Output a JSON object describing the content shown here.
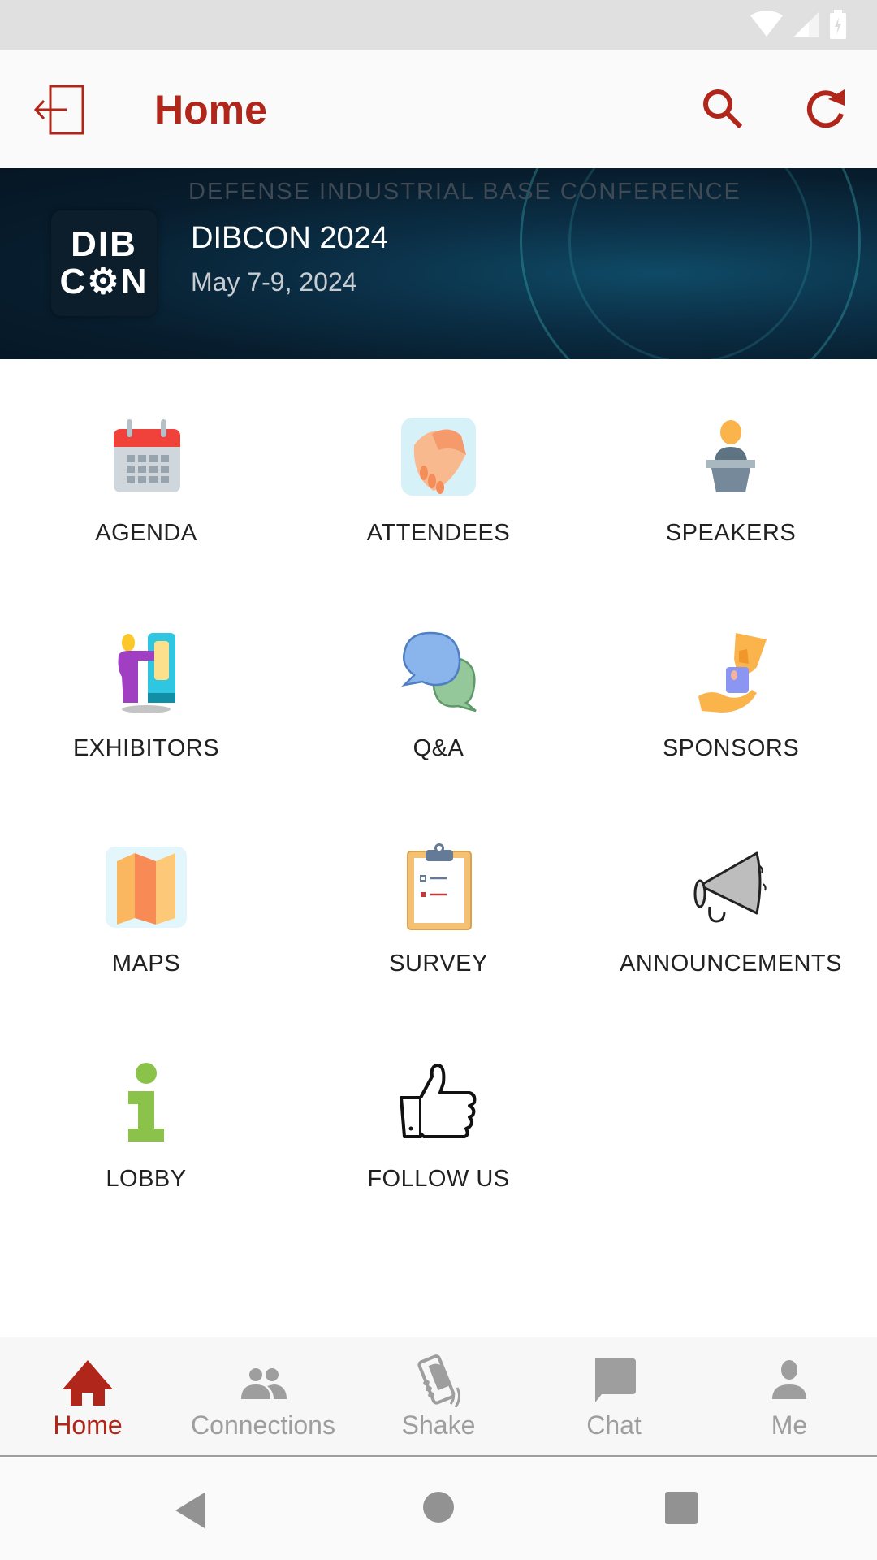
{
  "status_bar": {
    "icons": [
      "wifi-icon",
      "cell-signal-icon",
      "battery-charging-icon"
    ]
  },
  "app_bar": {
    "title": "Home",
    "left_icon": "logout-icon",
    "right_icons": [
      "search-icon",
      "refresh-icon"
    ]
  },
  "banner": {
    "tagline": "DEFENSE INDUSTRIAL BASE CONFERENCE",
    "logo_line1": "DIB",
    "logo_line2": "C⚙N",
    "event_name": "DIBCON 2024",
    "event_date": "May 7-9, 2024"
  },
  "grid": {
    "items": [
      {
        "label": "AGENDA",
        "icon": "calendar-icon"
      },
      {
        "label": "ATTENDEES",
        "icon": "handshake-icon"
      },
      {
        "label": "SPEAKERS",
        "icon": "speaker-podium-icon"
      },
      {
        "label": "EXHIBITORS",
        "icon": "exhibitor-booth-icon"
      },
      {
        "label": "Q&A",
        "icon": "chat-bubbles-icon"
      },
      {
        "label": "SPONSORS",
        "icon": "sponsor-hand-icon"
      },
      {
        "label": "MAPS",
        "icon": "map-icon"
      },
      {
        "label": "SURVEY",
        "icon": "clipboard-icon"
      },
      {
        "label": "ANNOUNCEMENTS",
        "icon": "megaphone-icon"
      },
      {
        "label": "LOBBY",
        "icon": "info-icon"
      },
      {
        "label": "FOLLOW US",
        "icon": "thumbs-up-icon"
      }
    ]
  },
  "bottom_nav": {
    "active": "Home",
    "items": [
      {
        "label": "Home",
        "icon": "home-icon"
      },
      {
        "label": "Connections",
        "icon": "people-icon"
      },
      {
        "label": "Shake",
        "icon": "shake-phone-icon"
      },
      {
        "label": "Chat",
        "icon": "chat-icon"
      },
      {
        "label": "Me",
        "icon": "person-icon"
      }
    ]
  },
  "system_nav": {
    "buttons": [
      "back-icon",
      "home-circle-icon",
      "recents-icon"
    ]
  },
  "colors": {
    "accent": "#b0261a",
    "inactive": "#9e9e9e",
    "status_bar": "#e0e0e0",
    "app_bar": "#fafafa"
  }
}
